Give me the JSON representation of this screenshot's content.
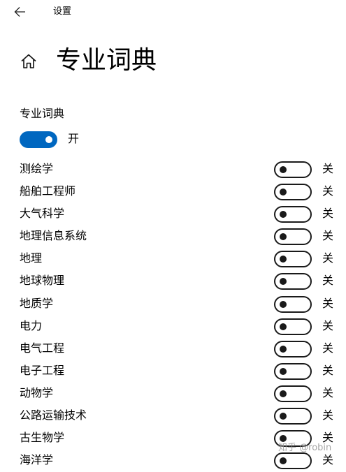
{
  "window": {
    "title": "设置"
  },
  "page": {
    "title": "专业词典"
  },
  "master": {
    "label": "专业词典",
    "state": "开",
    "on": true
  },
  "dictionaries": [
    {
      "name": "测绘学",
      "state": "关"
    },
    {
      "name": "船舶工程师",
      "state": "关"
    },
    {
      "name": "大气科学",
      "state": "关"
    },
    {
      "name": "地理信息系统",
      "state": "关"
    },
    {
      "name": "地理",
      "state": "关"
    },
    {
      "name": "地球物理",
      "state": "关"
    },
    {
      "name": "地质学",
      "state": "关"
    },
    {
      "name": "电力",
      "state": "关"
    },
    {
      "name": "电气工程",
      "state": "关"
    },
    {
      "name": "电子工程",
      "state": "关"
    },
    {
      "name": "动物学",
      "state": "关"
    },
    {
      "name": "公路运输技术",
      "state": "关"
    },
    {
      "name": "古生物学",
      "state": "关"
    },
    {
      "name": "海洋学",
      "state": "关"
    }
  ],
  "colors": {
    "accent": "#0067c0",
    "toggle_off_border": "#1a1a1a"
  },
  "icons": {
    "back": "back-arrow-icon",
    "home": "home-icon"
  },
  "watermark": {
    "text": "知乎 @robin"
  }
}
